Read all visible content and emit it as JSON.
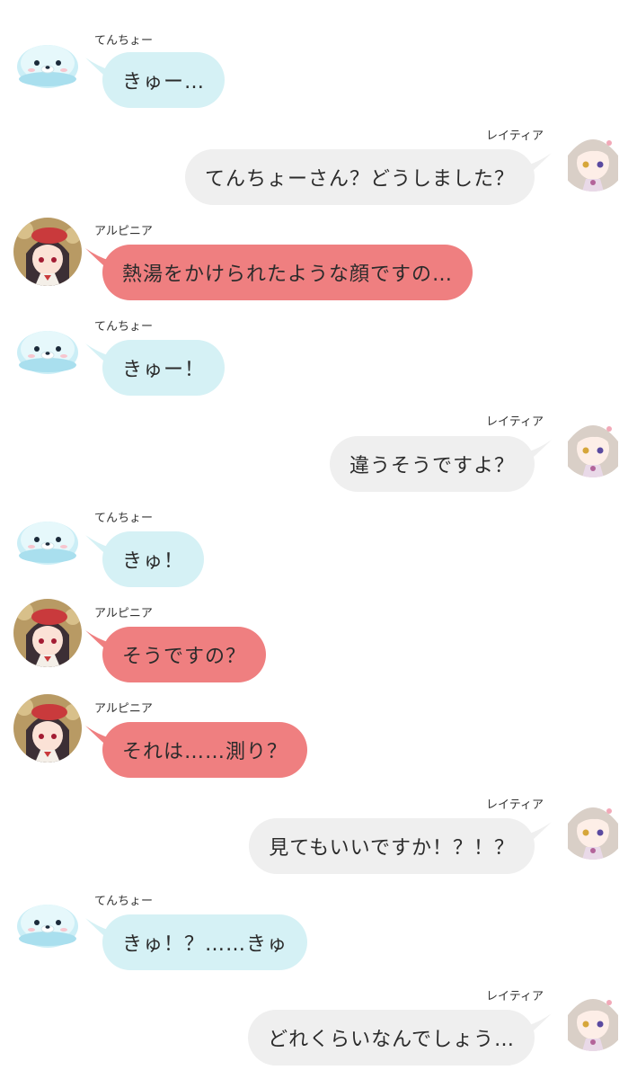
{
  "colors": {
    "tenchou": "#d5f1f5",
    "arupinia": "#ef7f80",
    "reitia": "#efefef"
  },
  "characters": {
    "tenchou": {
      "name": "てんちょー",
      "avatar": "seal-avatar-icon"
    },
    "arupinia": {
      "name": "アルピニア",
      "avatar": "girl-red-beret-avatar-icon"
    },
    "reitia": {
      "name": "レイティア",
      "avatar": "girl-silver-hair-avatar-icon"
    }
  },
  "messages": [
    {
      "speaker": "てんちょー",
      "text": "きゅー…"
    },
    {
      "speaker": "レイティア",
      "text": "てんちょーさん？どうしました？"
    },
    {
      "speaker": "アルピニア",
      "text": "熱湯をかけられたような顔ですの…"
    },
    {
      "speaker": "てんちょー",
      "text": "きゅー！"
    },
    {
      "speaker": "レイティア",
      "text": "違うそうですよ？"
    },
    {
      "speaker": "てんちょー",
      "text": "きゅ！"
    },
    {
      "speaker": "アルピニア",
      "text": "そうですの？"
    },
    {
      "speaker": "アルピニア",
      "text": "それは……測り？"
    },
    {
      "speaker": "レイティア",
      "text": "見てもいいですか！？！？"
    },
    {
      "speaker": "てんちょー",
      "text": "きゅ！？……きゅ"
    },
    {
      "speaker": "レイティア",
      "text": "どれくらいなんでしょう…"
    }
  ]
}
